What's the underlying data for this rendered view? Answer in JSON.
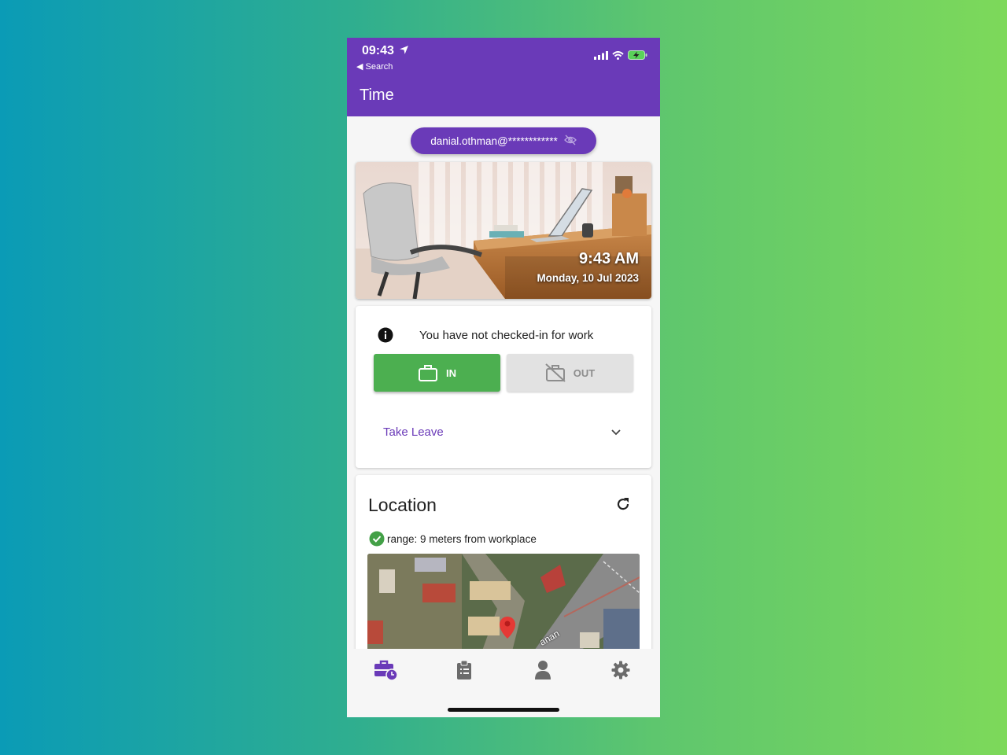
{
  "status_bar": {
    "time": "09:43",
    "back_label": "Search"
  },
  "app_bar": {
    "title": "Time"
  },
  "account": {
    "email": "danial.othman@************"
  },
  "hero": {
    "time": "9:43 AM",
    "date": "Monday, 10 Jul 2023"
  },
  "attendance": {
    "notice": "You have not checked-in for work",
    "in_label": "IN",
    "out_label": "OUT",
    "in_color": "#4caf50",
    "leave_label": "Take Leave"
  },
  "location": {
    "title": "Location",
    "range_text": "range: 9 meters from workplace",
    "map_street_label": "anan"
  },
  "bottom_nav": {
    "items": [
      {
        "icon": "business-time-icon",
        "active": true
      },
      {
        "icon": "clipboard-list-icon",
        "active": false
      },
      {
        "icon": "person-icon",
        "active": false
      },
      {
        "icon": "gear-icon",
        "active": false
      }
    ]
  },
  "colors": {
    "primary": "#6a3ab8",
    "success": "#4caf50"
  }
}
